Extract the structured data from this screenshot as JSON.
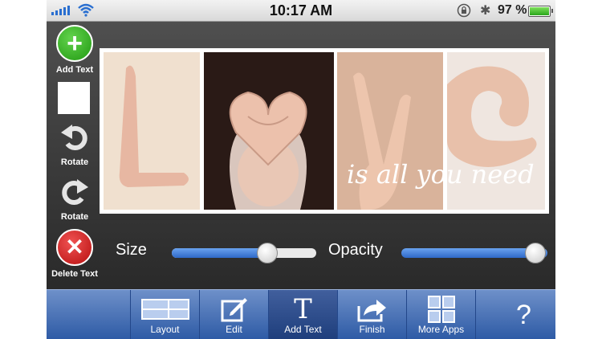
{
  "status_bar": {
    "time": "10:17 AM",
    "battery_percent": "97 %",
    "battery_level": 0.97
  },
  "side_panel": {
    "add_text_label": "Add Text",
    "rotate_left_label": "Rotate",
    "rotate_right_label": "Rotate",
    "delete_text_label": "Delete Text",
    "text_color": "#ffffff"
  },
  "collage": {
    "overlay_text": "is all you need"
  },
  "controls": {
    "size_label": "Size",
    "size_value": 0.55,
    "opacity_label": "Opacity",
    "opacity_value": 1.0
  },
  "toolbar": {
    "items": [
      {
        "label": "Layout",
        "icon": "layout-icon"
      },
      {
        "label": "Edit",
        "icon": "edit-icon"
      },
      {
        "label": "Add Text",
        "icon": "text-icon",
        "active": true
      },
      {
        "label": "Finish",
        "icon": "share-icon"
      },
      {
        "label": "More Apps",
        "icon": "grid-icon"
      }
    ],
    "help_label": "?"
  },
  "colors": {
    "toolbar": "#2d5aa5",
    "slider_fill": "#3f79d8",
    "add_button": "#2da51c",
    "delete_button": "#cf1c1c"
  }
}
